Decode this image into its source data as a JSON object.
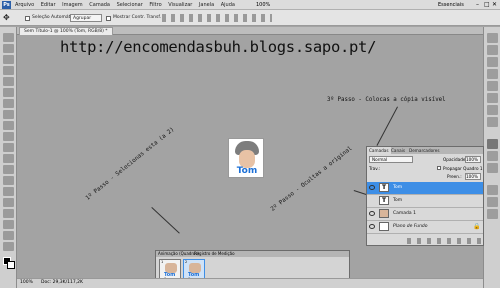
{
  "menu": [
    "Arquivo",
    "Editar",
    "Imagem",
    "Camada",
    "Selecionar",
    "Filtro",
    "Visualizar",
    "Janela",
    "Ajuda"
  ],
  "menu_right": {
    "zoom": "100%",
    "workspace": "Essenciais"
  },
  "options": {
    "autoselect": "Seleção Automática:",
    "group": "Agrupar",
    "transform": "Mostrar Contr. Transf."
  },
  "document": {
    "tab": "Sem Título-1 @ 100% (Tom, RGB/8) *"
  },
  "canvas": {
    "url": "http://encomendasbuh.blogs.sapo.pt/",
    "step1": "1º Passo - Selecionas esta (a 2)",
    "step2": "2º Passo - Ocultas a original",
    "step3": "3º Passo - Colocas a cópia visível",
    "photo_label": "Tom"
  },
  "layers_panel": {
    "tabs": [
      "Camadas",
      "Canais",
      "Demarcadores"
    ],
    "blend_mode": "Normal",
    "opacity_label": "Opacidade:",
    "opacity": "100%",
    "lock_label": "Trav.:",
    "propagate": "Propagar Quadro 1",
    "fill_label": "Preen.:",
    "fill": "100%",
    "layers": [
      {
        "name": "Tom",
        "type": "text",
        "selected": true,
        "visible": true
      },
      {
        "name": "Tom",
        "type": "text",
        "selected": false,
        "visible": false
      },
      {
        "name": "Camada 1",
        "type": "image",
        "selected": false,
        "visible": true
      },
      {
        "name": "Plano de Fundo",
        "type": "background",
        "selected": false,
        "visible": true
      }
    ]
  },
  "animation_panel": {
    "tabs": [
      "Animação (Quadros)",
      "Registro de Medição"
    ],
    "frames": [
      {
        "number": "1",
        "delay": "0 seg.",
        "label": "Tom"
      },
      {
        "number": "2",
        "delay": "0 seg.",
        "label": "Tom"
      }
    ],
    "loop": "Sempre"
  },
  "status": {
    "zoom": "100%",
    "doc": "Doc: 29,3K/117,2K"
  },
  "colors": {
    "selected_layer": "#3d8ee6",
    "panel": "#d9d9d9",
    "workspace": "#a3a3a3",
    "photo_text": "#1b6fd6"
  }
}
